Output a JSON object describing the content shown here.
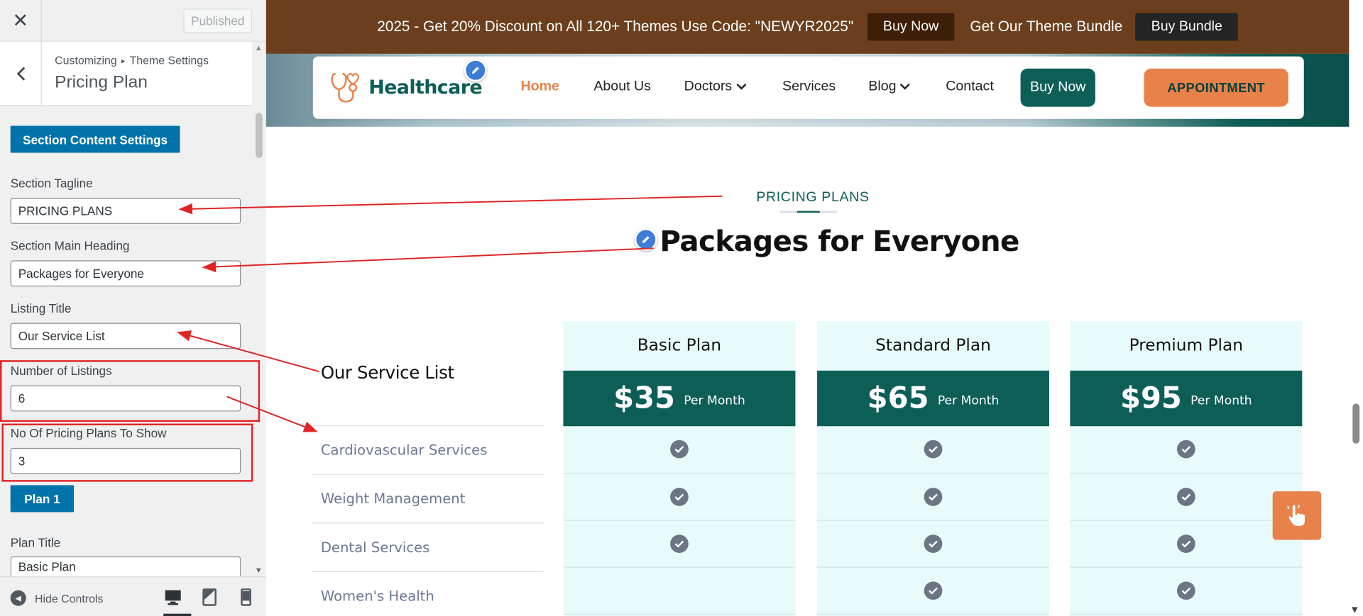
{
  "sidebar": {
    "published_label": "Published",
    "breadcrumb": [
      "Customizing",
      "Theme Settings"
    ],
    "title": "Pricing Plan",
    "section_button": "Section Content Settings",
    "fields": {
      "tagline": {
        "label": "Section Tagline",
        "value": "PRICING PLANS"
      },
      "heading": {
        "label": "Section Main Heading",
        "value": "Packages for Everyone"
      },
      "listing_title": {
        "label": "Listing Title",
        "value": "Our Service List"
      },
      "num_listings": {
        "label": "Number of Listings",
        "value": "6"
      },
      "num_plans": {
        "label": "No Of Pricing Plans To Show",
        "value": "3"
      },
      "plan_title": {
        "label": "Plan Title",
        "value": "Basic Plan"
      }
    },
    "plan_button": "Plan 1",
    "hide_controls": "Hide Controls"
  },
  "topbar": {
    "promo": "2025 - Get 20% Discount on All 120+ Themes Use Code: \"NEWYR2025\"",
    "buy_now": "Buy Now",
    "bundle_text": "Get Our Theme Bundle",
    "buy_bundle": "Buy Bundle"
  },
  "nav": {
    "logo": "Healthcare",
    "items": [
      "Home",
      "About Us",
      "Doctors",
      "Services",
      "Blog",
      "Contact"
    ],
    "buy_now": "Buy Now",
    "appointment": "APPOINTMENT"
  },
  "pricing": {
    "tagline": "PRICING PLANS",
    "heading": "Packages for Everyone",
    "list_title": "Our Service List",
    "services": [
      "Cardiovascular Services",
      "Weight Management",
      "Dental Services",
      "Women's Health"
    ],
    "plans": [
      {
        "title": "Basic Plan",
        "price": "$35",
        "per": "Per Month",
        "checks": [
          true,
          true,
          true,
          false
        ]
      },
      {
        "title": "Standard Plan",
        "price": "$65",
        "per": "Per Month",
        "checks": [
          true,
          true,
          true,
          true
        ]
      },
      {
        "title": "Premium Plan",
        "price": "$95",
        "per": "Per Month",
        "checks": [
          true,
          true,
          true,
          true
        ]
      }
    ]
  },
  "colors": {
    "accent_teal": "#0e5e58",
    "accent_orange": "#e8824a",
    "wp_blue": "#0073aa",
    "annotation_red": "#e02424"
  }
}
